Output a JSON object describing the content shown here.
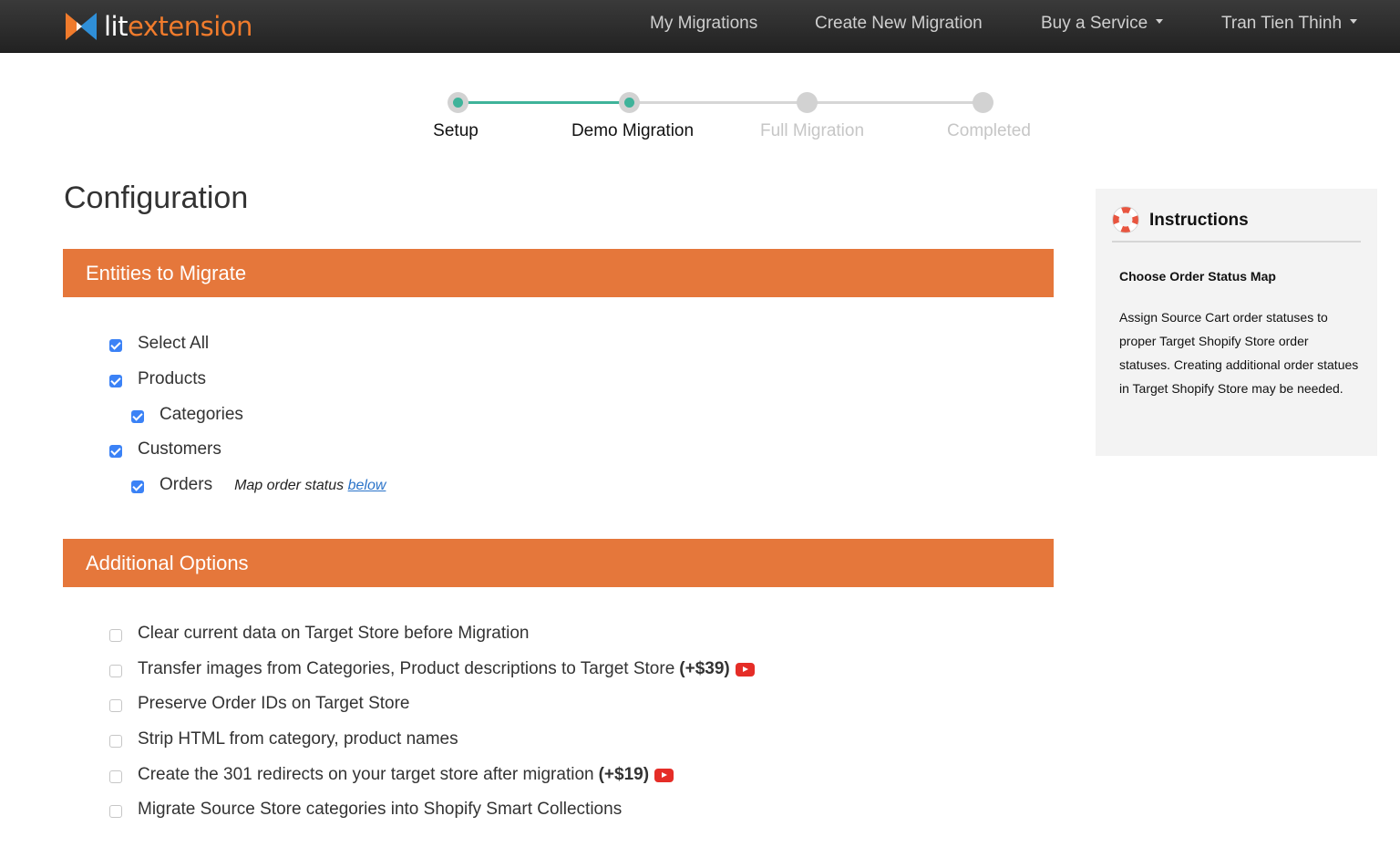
{
  "brand": {
    "lit": "lit",
    "extension": "extension",
    "accent_color": "#f07b2c"
  },
  "nav": {
    "my_migrations": "My Migrations",
    "create_new_migration": "Create New Migration",
    "buy_a_service": "Buy a Service",
    "user_name": "Tran Tien Thinh"
  },
  "stepper": {
    "steps": [
      {
        "label": "Setup",
        "state": "done"
      },
      {
        "label": "Demo Migration",
        "state": "done"
      },
      {
        "label": "Full Migration",
        "state": "pending"
      },
      {
        "label": "Completed",
        "state": "pending"
      }
    ],
    "progress_color": "#3fb39a"
  },
  "page_title": "Configuration",
  "entities": {
    "header": "Entities to Migrate",
    "items": [
      {
        "label": "Select All",
        "checked": true
      },
      {
        "label": "Products",
        "checked": true
      },
      {
        "label": "Categories",
        "checked": true
      },
      {
        "label": "Customers",
        "checked": true
      },
      {
        "label": "Orders",
        "checked": true
      }
    ],
    "orders_note": "Map order status",
    "orders_note_link": "below"
  },
  "additional": {
    "header": "Additional Options",
    "items": [
      {
        "label": "Clear current data on Target Store before Migration",
        "checked": false
      },
      {
        "label": "Transfer images from Categories, Product descriptions to Target Store",
        "price": "(+$39)",
        "checked": false,
        "icon": "youtube-icon"
      },
      {
        "label": "Preserve Order IDs on Target Store",
        "checked": false
      },
      {
        "label": "Strip HTML from category, product names",
        "checked": false
      },
      {
        "label": "Create the 301 redirects on your target store after migration",
        "price": "(+$19)",
        "checked": false,
        "icon": "youtube-icon"
      },
      {
        "label": "Migrate Source Store categories into Shopify Smart Collections",
        "checked": false
      }
    ],
    "section_color": "#e5773b"
  },
  "instructions": {
    "title": "Instructions",
    "subtitle": "Choose Order Status Map",
    "body": "Assign Source Cart order statuses to proper Target Shopify Store order statuses. Creating additional order statues in Target Shopify Store may be needed.",
    "icon": "lifebuoy-icon"
  }
}
